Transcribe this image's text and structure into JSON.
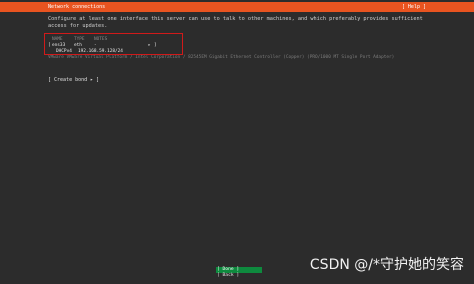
{
  "header": {
    "title": "Network connections",
    "help_label": "[ Help ]"
  },
  "description": {
    "line1": "Configure at least one interface this server can use to talk to other machines, and which preferably provides sufficient",
    "line2": "access for updates."
  },
  "table": {
    "headers": {
      "name": "NAME",
      "type": "TYPE",
      "notes": "NOTES"
    },
    "bracket_open": "[",
    "bracket_close": "]",
    "arrow": "▸",
    "interface": {
      "name": "ens33",
      "type": "eth",
      "notes": "-"
    },
    "address": {
      "proto": "DHCPv4",
      "ip": "192.168.59.128/24"
    },
    "hardware": "VMware VMware Virtual Platform / Intel Corporation / 82545EM Gigabit Ethernet Controller (Copper) (PRO/1000 MT Single Port Adapter)"
  },
  "create_bond_label": "[ Create bond ▸ ]",
  "footer": {
    "done_label": "[ Done ]",
    "back_label": "[ Back ]"
  },
  "watermark": "CSDN @/*守护她的笑容",
  "colors": {
    "title_bar": "#e95420",
    "done_button": "#0e8a3e",
    "highlight_box": "#d11a1a",
    "background": "#2c2c2c"
  }
}
